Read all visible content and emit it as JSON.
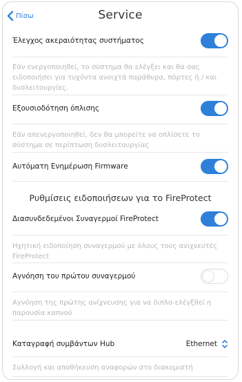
{
  "header": {
    "back_label": "Πίσω",
    "title": "Service"
  },
  "settings": [
    {
      "label": "Έλεγχος ακεραιότητας συστήματος",
      "toggle": true,
      "description": "Εάν ενεργοποιηθεί, το σύστημα θα ελέγξει και θα σας ειδοποιήσει για τυχόντα ανοιχτά παράθυρα, πόρτες ή / και δυσλειτουργίες."
    },
    {
      "label": "Εξουσιοδότηση όπλισης",
      "toggle": true,
      "description": "Εάν απενεργοποιηθεί, δεν θα μπορείτε να οπλίσετε το σύστημα σε περίπτωση δυσλειτουργίας"
    },
    {
      "label": "Αυτόματη Ενημέρωση Firmware",
      "toggle": true
    }
  ],
  "fireprotect": {
    "section_title": "Ρυθμίσεις ειδοποιήσεων για το FireProtect",
    "items": [
      {
        "label": "Διασυνδεδεμένοι Συναγερμοί FireProtect",
        "toggle": true,
        "description": "Ηχητική ειδοποίηση συναγερμού με όλους τους ανιχνευτές FireProtect"
      },
      {
        "label": "Αγνόηση του πρώτου συναγερμού",
        "toggle": false,
        "description": "Αγνόηση της πρώτης ανίχνευσης για να διπλο-ελέγξθεί η παρουσία καπνού"
      }
    ]
  },
  "hub_log": {
    "label": "Καταγραφή συμβάντων Hub",
    "value": "Ethernet",
    "description": "Συλλογή και αποθήκευση αναφορών στο διακομιστή"
  },
  "colors": {
    "accent": "#2f80d9",
    "description_text": "#b7b7b7",
    "divider": "#e6e6e6"
  },
  "icons": {
    "back": "chevron-left-icon",
    "select": "chevron-up-down-icon"
  }
}
